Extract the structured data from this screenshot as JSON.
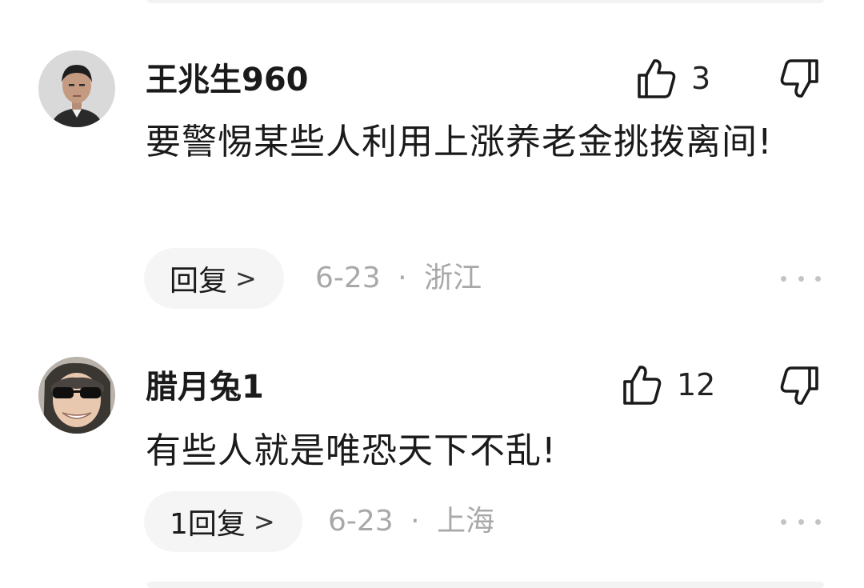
{
  "comments": [
    {
      "username": "王兆生960",
      "text": "要警惕某些人利用上涨养老金挑拨离间!",
      "like_count": "3",
      "reply_label": "回复",
      "date": "6-23",
      "separator": "·",
      "location": "浙江",
      "avatar_icon": "portrait-man-icon"
    },
    {
      "username": "腊月兔1",
      "text": "有些人就是唯恐天下不乱!",
      "like_count": "12",
      "reply_label": "1回复",
      "date": "6-23",
      "separator": "·",
      "location": "上海",
      "avatar_icon": "portrait-sunglasses-icon"
    }
  ],
  "icons": {
    "like": "thumbs-up-icon",
    "dislike": "thumbs-down-icon",
    "more": "more-dots-icon",
    "chevron": "chevron-right-icon"
  },
  "colors": {
    "text": "#1a1a1a",
    "meta": "#a8a8a8",
    "pill_bg": "#f5f5f5"
  }
}
